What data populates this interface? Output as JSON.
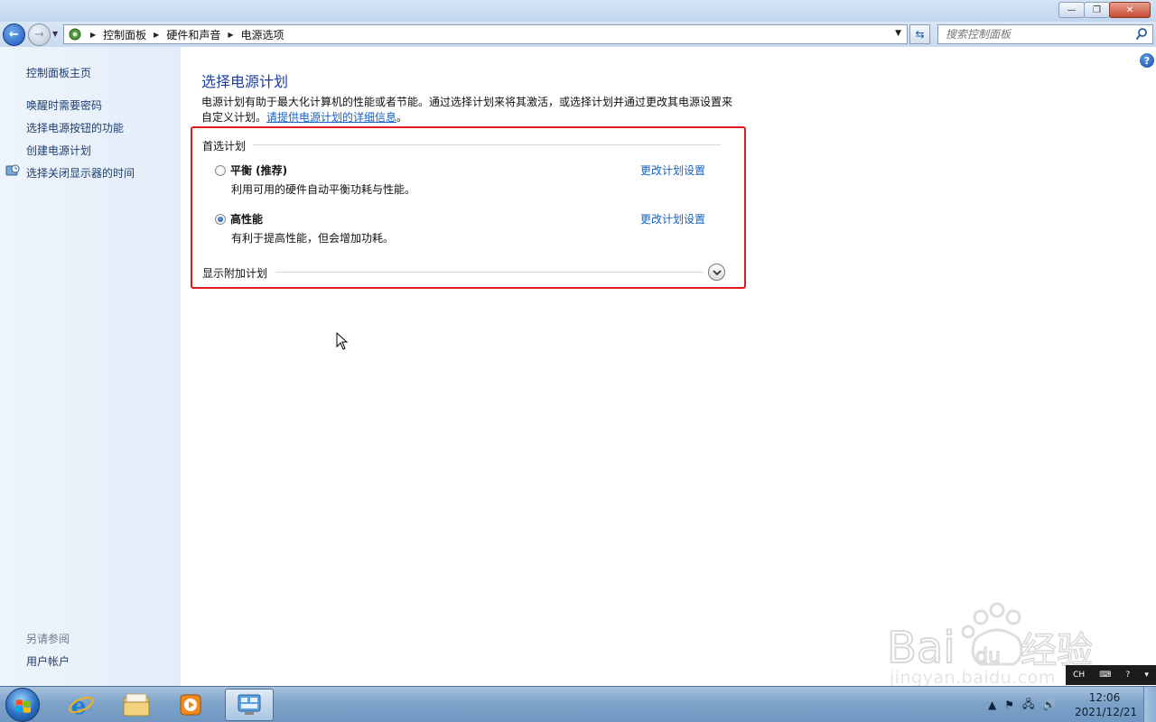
{
  "window": {
    "minimize": "—",
    "maximize": "❐",
    "close": "✕"
  },
  "address": {
    "crumbs": [
      "控制面板",
      "硬件和声音",
      "电源选项"
    ],
    "search_placeholder": "搜索控制面板"
  },
  "sidebar": {
    "home": "控制面板主页",
    "links": [
      "唤醒时需要密码",
      "选择电源按钮的功能",
      "创建电源计划",
      "选择关闭显示器的时间"
    ],
    "see_also": "另请参阅",
    "see_also_links": [
      "用户帐户"
    ]
  },
  "main": {
    "title": "选择电源计划",
    "desc": "电源计划有助于最大化计算机的性能或者节能。通过选择计划来将其激活，或选择计划并通过更改其电源设置来自定义计划。",
    "desc_link": "请提供电源计划的详细信息",
    "desc_tail": "。",
    "group_label": "首选计划",
    "plans": [
      {
        "name": "平衡 (推荐)",
        "desc": "利用可用的硬件自动平衡功耗与性能。",
        "link": "更改计划设置",
        "checked": false
      },
      {
        "name": "高性能",
        "desc": "有利于提高性能，但会增加功耗。",
        "link": "更改计划设置",
        "checked": true
      }
    ],
    "show_more": "显示附加计划"
  },
  "watermark": {
    "text": "jingyan.baidu.com",
    "brand": "Bai经验"
  },
  "taskbar": {
    "ime": "CH",
    "time": "12:06",
    "date": "2021/12/21"
  },
  "colors": {
    "accent_link": "#1662c4",
    "title_blue": "#1e3e9e",
    "highlight_red": "#e0191c"
  }
}
